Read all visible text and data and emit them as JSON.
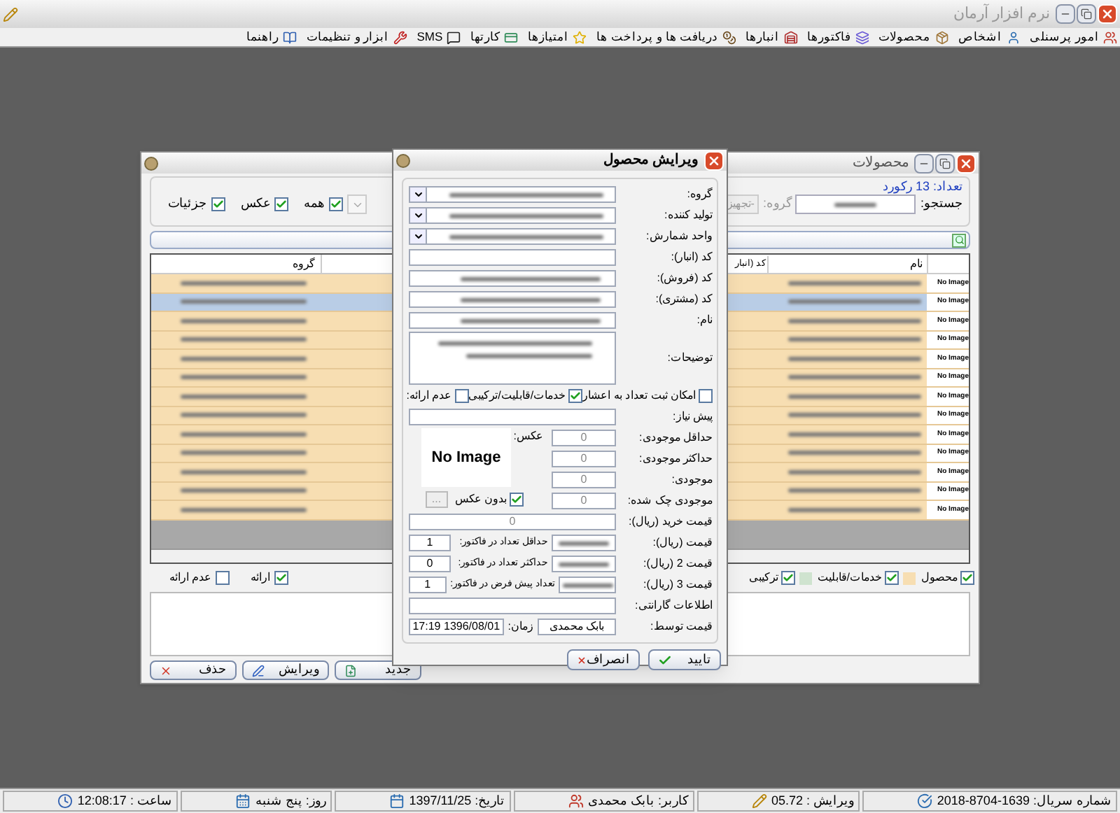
{
  "app": {
    "title": "نرم افزار آرمان"
  },
  "menu": [
    {
      "label": "امور پرسنلی",
      "kind": "staff"
    },
    {
      "label": "اشخاص",
      "kind": "people"
    },
    {
      "label": "محصولات",
      "kind": "products"
    },
    {
      "label": "فاکتورها",
      "kind": "invoices"
    },
    {
      "label": "انبارها",
      "kind": "stores"
    },
    {
      "label": "دریافت ها و پرداخت ها",
      "kind": "payments"
    },
    {
      "label": "امتیازها",
      "kind": "points"
    },
    {
      "label": "کارتها",
      "kind": "cards"
    },
    {
      "label": "SMS",
      "kind": "sms"
    },
    {
      "label": "ابزار و تنظیمات",
      "kind": "tools"
    },
    {
      "label": "راهنما",
      "kind": "help"
    }
  ],
  "products_window": {
    "title": "محصولات",
    "record_count": "تعداد: 13 رکورد",
    "search_label": "جستجو:",
    "group_label": "گروه:",
    "group_value": "-تجهیز",
    "filters": [
      {
        "label": "همه",
        "checked": true
      },
      {
        "label": "عکس",
        "checked": true
      },
      {
        "label": "جزئیات",
        "checked": true
      }
    ],
    "columns": [
      {
        "label": "نام"
      },
      {
        "label": "کد (انبار"
      },
      {
        "label": "گروه"
      }
    ],
    "rows": [
      {
        "image": "No Image",
        "selected": false
      },
      {
        "image": "No Image",
        "selected": true
      },
      {
        "image": "No Image",
        "selected": false
      },
      {
        "image": "No Image",
        "selected": false
      },
      {
        "image": "No Image",
        "selected": false
      },
      {
        "image": "No Image",
        "selected": false
      },
      {
        "image": "No Image",
        "selected": false
      },
      {
        "image": "No Image",
        "selected": false
      },
      {
        "image": "No Image",
        "selected": false
      },
      {
        "image": "No Image",
        "selected": false
      },
      {
        "image": "No Image",
        "selected": false
      },
      {
        "image": "No Image",
        "selected": false
      },
      {
        "image": "No Image",
        "selected": false
      }
    ],
    "legend": [
      {
        "label": "محصول",
        "checked": true,
        "color": "#f7deb2"
      },
      {
        "label": "خدمات/قابلیت",
        "checked": true,
        "color": "#cfe3cf"
      },
      {
        "label": "ترکیبی",
        "checked": true
      }
    ],
    "availability": [
      {
        "label": "ارائه",
        "checked": true
      },
      {
        "label": "عدم ارائه",
        "checked": false
      }
    ],
    "buttons": [
      {
        "label": "جدید",
        "kind": "new"
      },
      {
        "label": "ویرایش",
        "kind": "edit"
      },
      {
        "label": "حذف",
        "kind": "delete"
      }
    ]
  },
  "edit_dialog": {
    "title": "ویرایش محصول",
    "fields": [
      {
        "label": "گروه:",
        "kind": "select",
        "blurred": true
      },
      {
        "label": "تولید کننده:",
        "kind": "select",
        "blurred": true
      },
      {
        "label": "واحد شمارش:",
        "kind": "select",
        "blurred": true
      },
      {
        "label": "کد (انبار):",
        "kind": "text",
        "blurred": false
      },
      {
        "label": "کد (فروش):",
        "kind": "text",
        "blurred": true
      },
      {
        "label": "کد (مشتری):",
        "kind": "text",
        "blurred": true
      },
      {
        "label": "نام:",
        "kind": "text",
        "blurred": true
      },
      {
        "label": "توضیحات:",
        "kind": "textarea",
        "blurred": true
      }
    ],
    "options": [
      {
        "label": "امکان ثبت تعداد به اعشار",
        "checked": false
      },
      {
        "label": "خدمات/قابلیت/ترکیبی",
        "checked": true
      },
      {
        "label": "عدم ارائه:",
        "checked": false
      }
    ],
    "prerequisite_label": "پیش نیاز:",
    "image_label": "عکس:",
    "image": "No Image",
    "no_image": {
      "label": "بدون عکس",
      "checked": true
    },
    "browse": "...",
    "stock": [
      {
        "label": "حداقل موجودی:",
        "value": "0"
      },
      {
        "label": "حداکثر موجودی:",
        "value": "0"
      },
      {
        "label": "موجودی:",
        "value": "0"
      },
      {
        "label": "موجودی چک شده:",
        "value": "0"
      }
    ],
    "purchase_price": {
      "label": "قیمت خرید (ریال):",
      "value": "0"
    },
    "prices": [
      {
        "label": "قیمت (ریال):",
        "qty_label": "حداقل تعداد در فاکتور:",
        "qty": "1"
      },
      {
        "label": "قیمت 2 (ریال):",
        "qty_label": "حداکثر تعداد در فاکتور:",
        "qty": "0"
      },
      {
        "label": "قیمت 3 (ریال):",
        "qty_label": "تعداد پیش فرض در فاکتور:",
        "qty": "1"
      }
    ],
    "warranty_label": "اطلاعات گارانتی:",
    "priced_by": {
      "label": "قیمت توسط:",
      "value": "بابک محمدی",
      "time_label": "زمان:",
      "time": "1396/08/01 17:19"
    },
    "buttons": [
      {
        "label": "تایید",
        "kind": "ok"
      },
      {
        "label": "انصراف",
        "kind": "cancel"
      }
    ]
  },
  "status_bar": [
    {
      "text": "شماره سریال: 1639-8704-2018",
      "kind": "serial"
    },
    {
      "text": "ویرایش : 05.72",
      "kind": "version"
    },
    {
      "text": "کاربر: بابک محمدی",
      "kind": "user"
    },
    {
      "text": "تاریخ: 1397/11/25",
      "kind": "date"
    },
    {
      "text": "روز: پنج شنبه",
      "kind": "day"
    },
    {
      "text": "ساعت : 12:08:17",
      "kind": "time"
    }
  ]
}
